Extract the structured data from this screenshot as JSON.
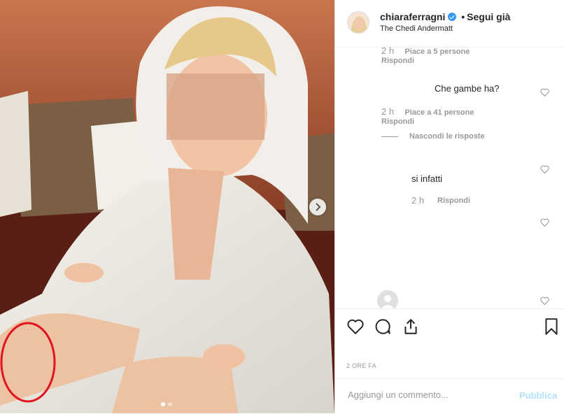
{
  "post": {
    "username": "chiaraferragni",
    "follow_label": "Segui già",
    "bullet": "•",
    "location": "The Chedi Andermatt"
  },
  "comments": [
    {
      "time": "2 h",
      "likes": "Piace a 5 persone",
      "reply": "Rispondi"
    },
    {
      "text": "Che gambe ha?",
      "time": "2 h",
      "likes": "Piace a 41 persone",
      "reply": "Rispondi",
      "hide_replies": "Nascondi le risposte"
    },
    {
      "text": "si infatti",
      "time": "2 h",
      "reply": "Rispondi"
    }
  ],
  "actions": {
    "date": "2 ORE FA"
  },
  "add_comment": {
    "placeholder": "Aggiungi un commento...",
    "publish": "Pubblica"
  },
  "carousel": {
    "current": 1,
    "total": 2
  },
  "colors": {
    "verified": "#3897f0",
    "publish_disabled": "#b2dffc",
    "annotation_circle": "#e0141e"
  },
  "icons": [
    "verified-badge-icon",
    "heart-icon",
    "comment-icon",
    "share-icon",
    "bookmark-icon",
    "chevron-right-icon"
  ]
}
